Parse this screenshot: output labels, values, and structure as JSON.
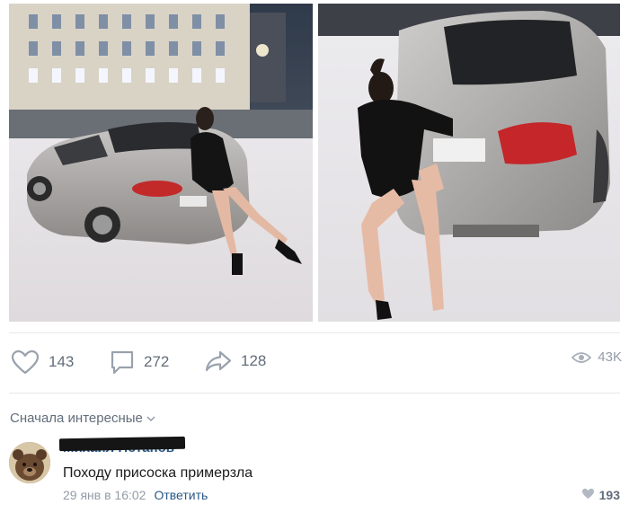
{
  "post": {
    "photos": [
      {
        "id_name": "photo-left"
      },
      {
        "id_name": "photo-right"
      }
    ],
    "actions": {
      "likes": "143",
      "comments": "272",
      "shares": "128",
      "views": "43K"
    }
  },
  "comments_section": {
    "sort_label": "Сначала интересные",
    "comment": {
      "author": "Михаил Потапов",
      "text": "Походу присоска примерзла",
      "date": "29 янв в 16:02",
      "reply_label": "Ответить",
      "likes": "193"
    }
  },
  "colors": {
    "accent": "#2a5885",
    "muted": "#939ca8",
    "icon": "#626d7a",
    "divider": "#e7e8ec"
  },
  "icons": [
    "heart-icon",
    "comment-icon",
    "share-icon",
    "eye-icon",
    "chevron-down-icon",
    "heart-small-icon"
  ]
}
